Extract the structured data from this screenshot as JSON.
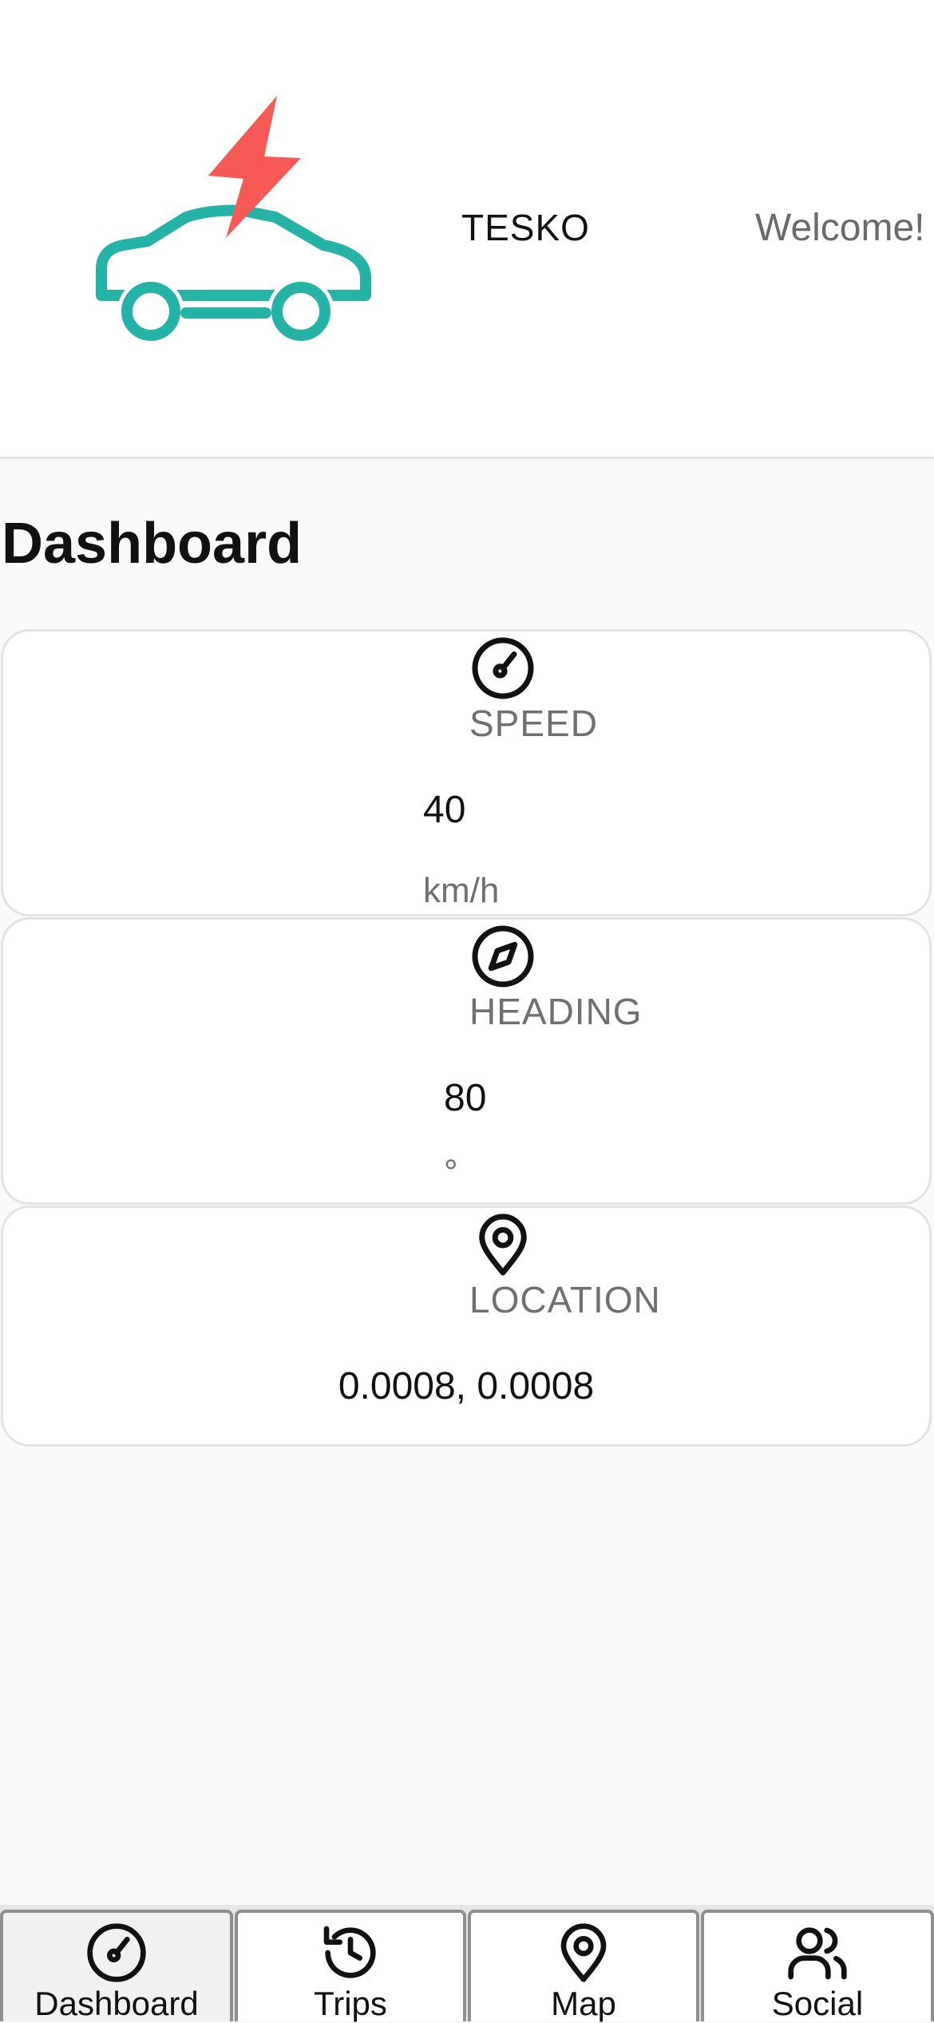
{
  "header": {
    "brand": "TESKO",
    "welcome": "Welcome!",
    "colors": {
      "car": "#26b3a7",
      "bolt": "#f75a55"
    }
  },
  "page": {
    "title": "Dashboard"
  },
  "cards": {
    "speed": {
      "icon": "speedometer-icon",
      "label": "SPEED",
      "value": "40",
      "unit": "km/h"
    },
    "heading": {
      "icon": "compass-icon",
      "label": "HEADING",
      "value": "80",
      "unit": "°"
    },
    "location": {
      "icon": "map-pin-icon",
      "label": "LOCATION",
      "value": "0.0008, 0.0008"
    }
  },
  "nav": {
    "items": [
      {
        "label": "Dashboard",
        "icon": "speedometer-icon",
        "active": true
      },
      {
        "label": "Trips",
        "icon": "history-icon",
        "active": false
      },
      {
        "label": "Map",
        "icon": "map-pin-icon",
        "active": false
      },
      {
        "label": "Social",
        "icon": "users-icon",
        "active": false
      }
    ]
  }
}
